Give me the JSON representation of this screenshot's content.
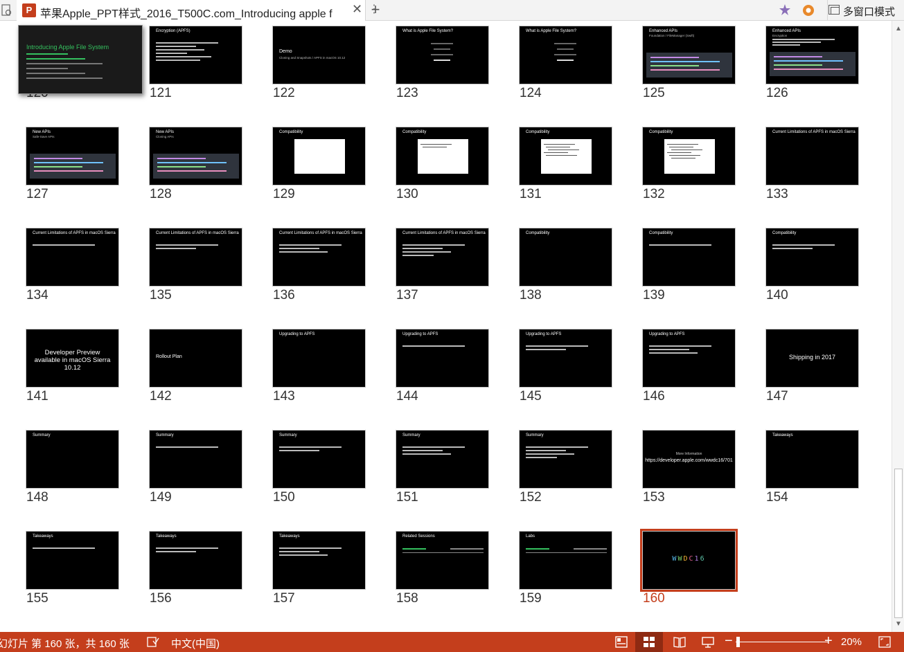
{
  "tab": {
    "title": "苹果Apple_PPT样式_2016_T500C.com_Introducing apple f",
    "close": "✕",
    "more": "⋮",
    "new_tab": "+"
  },
  "toolbar": {
    "multi_window_label": "多窗口模式"
  },
  "slides": [
    {
      "num": "120",
      "title": "Introducing Apple File System",
      "kind": "cover"
    },
    {
      "num": "121",
      "title": "Encryption (APFS)",
      "kind": "bullets",
      "bullets": 6
    },
    {
      "num": "122",
      "title": "Demo",
      "sub": "Cloning and Snapshots / APFS in macOS 10.12",
      "kind": "demo"
    },
    {
      "num": "123",
      "title": "What is Apple File System?",
      "kind": "centerlist"
    },
    {
      "num": "124",
      "title": "What is Apple File System?",
      "kind": "centerlist"
    },
    {
      "num": "125",
      "title": "Enhanced APIs",
      "sub": "Foundation / FileManager (Swift)",
      "kind": "code"
    },
    {
      "num": "126",
      "title": "Enhanced APIs",
      "sub": "Encryption",
      "kind": "code2"
    },
    {
      "num": "127",
      "title": "New APIs",
      "sub": "Safe-Save APIs",
      "kind": "code"
    },
    {
      "num": "128",
      "title": "New APIs",
      "sub": "Cloning APIs",
      "kind": "code"
    },
    {
      "num": "129",
      "title": "Compatibility",
      "kind": "whitebox"
    },
    {
      "num": "130",
      "title": "Compatibility",
      "kind": "whitebox"
    },
    {
      "num": "131",
      "title": "Compatibility",
      "kind": "whitebox"
    },
    {
      "num": "132",
      "title": "Compatibility",
      "kind": "whitebox"
    },
    {
      "num": "133",
      "title": "Current Limitations of APFS in macOS Sierra",
      "kind": "title"
    },
    {
      "num": "134",
      "title": "Current Limitations of APFS in macOS Sierra",
      "kind": "bullets",
      "bullets": 1
    },
    {
      "num": "135",
      "title": "Current Limitations of APFS in macOS Sierra",
      "kind": "bullets",
      "bullets": 2
    },
    {
      "num": "136",
      "title": "Current Limitations of APFS in macOS Sierra",
      "kind": "bullets",
      "bullets": 3
    },
    {
      "num": "137",
      "title": "Current Limitations of APFS in macOS Sierra",
      "kind": "bullets",
      "bullets": 4
    },
    {
      "num": "138",
      "title": "Compatibility",
      "kind": "title"
    },
    {
      "num": "139",
      "title": "Compatibility",
      "kind": "bullets",
      "bullets": 1
    },
    {
      "num": "140",
      "title": "Compatibility",
      "kind": "bullets",
      "bullets": 2
    },
    {
      "num": "141",
      "title": "Developer Preview available in macOS Sierra 10.12",
      "kind": "big"
    },
    {
      "num": "142",
      "title": "Rollout Plan",
      "kind": "leftmid"
    },
    {
      "num": "143",
      "title": "Upgrading to APFS",
      "kind": "title"
    },
    {
      "num": "144",
      "title": "Upgrading to APFS",
      "kind": "bullets",
      "bullets": 1
    },
    {
      "num": "145",
      "title": "Upgrading to APFS",
      "kind": "bullets",
      "bullets": 2
    },
    {
      "num": "146",
      "title": "Upgrading to APFS",
      "kind": "bullets",
      "bullets": 3
    },
    {
      "num": "147",
      "title": "Shipping in 2017",
      "kind": "centermid"
    },
    {
      "num": "148",
      "title": "Summary",
      "kind": "title"
    },
    {
      "num": "149",
      "title": "Summary",
      "kind": "bullets",
      "bullets": 1
    },
    {
      "num": "150",
      "title": "Summary",
      "kind": "bullets",
      "bullets": 2
    },
    {
      "num": "151",
      "title": "Summary",
      "kind": "bullets",
      "bullets": 3
    },
    {
      "num": "152",
      "title": "Summary",
      "kind": "bullets",
      "bullets": 4
    },
    {
      "num": "153",
      "title": "More Information",
      "sub": "https://developer.apple.com/wwdc16/701",
      "kind": "moreinfo"
    },
    {
      "num": "154",
      "title": "Takeaways",
      "kind": "title"
    },
    {
      "num": "155",
      "title": "Takeaways",
      "kind": "bullets",
      "bullets": 1
    },
    {
      "num": "156",
      "title": "Takeaways",
      "kind": "bullets",
      "bullets": 2
    },
    {
      "num": "157",
      "title": "Takeaways",
      "kind": "bullets",
      "bullets": 3
    },
    {
      "num": "158",
      "title": "Related Sessions",
      "kind": "related"
    },
    {
      "num": "159",
      "title": "Labs",
      "kind": "related"
    },
    {
      "num": "160",
      "title": "WWDC16",
      "kind": "wwdc",
      "selected": true
    }
  ],
  "status": {
    "slide_info": "幻灯片 第 160 张，共 160 张",
    "language": "中文(中国)",
    "zoom": "20%",
    "zoom_minus": "−",
    "zoom_plus": "+"
  },
  "colors": {
    "accent": "#c43e1c",
    "slide_bg": "#000000",
    "status_bg": "#c43e1c"
  }
}
